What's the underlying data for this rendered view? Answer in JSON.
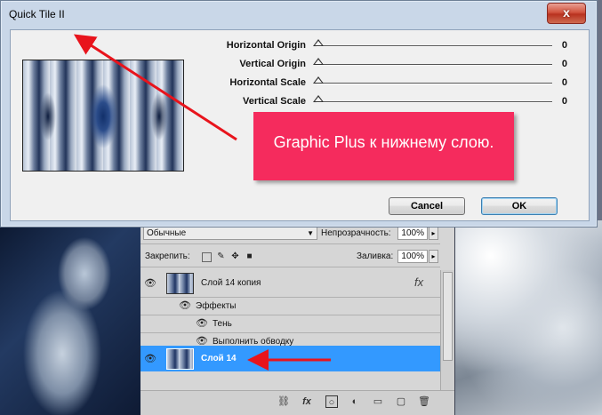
{
  "dialog": {
    "title": "Quick Tile II",
    "close_glyph": "x",
    "params": [
      {
        "label": "Horizontal Origin",
        "value": "0"
      },
      {
        "label": "Vertical Origin",
        "value": "0"
      },
      {
        "label": "Horizontal Scale",
        "value": "0"
      },
      {
        "label": "Vertical Scale",
        "value": "0"
      }
    ],
    "cancel_label": "Cancel",
    "ok_label": "OK"
  },
  "annotation": {
    "text": "Graphic Plus к нижнему слою.",
    "color": "#f52b5d",
    "arrow_color": "#e8141c"
  },
  "layers_panel": {
    "blend_mode": "Обычные",
    "opacity_label": "Непрозрачность:",
    "opacity_value": "100%",
    "lock_label": "Закрепить:",
    "fill_label": "Заливка:",
    "fill_value": "100%",
    "layers": [
      {
        "name": "Слой 14 копия",
        "fx": "fx",
        "selected": false
      },
      {
        "name": "Слой 14",
        "selected": true
      }
    ],
    "effects_label": "Эффекты",
    "effects": [
      "Тень",
      "Выполнить обводку"
    ],
    "selected_color": "#3399ff",
    "footer_icons": [
      "link-icon",
      "fx-icon",
      "mask-icon",
      "adjustment-icon",
      "folder-icon",
      "new-layer-icon",
      "trash-icon"
    ]
  }
}
